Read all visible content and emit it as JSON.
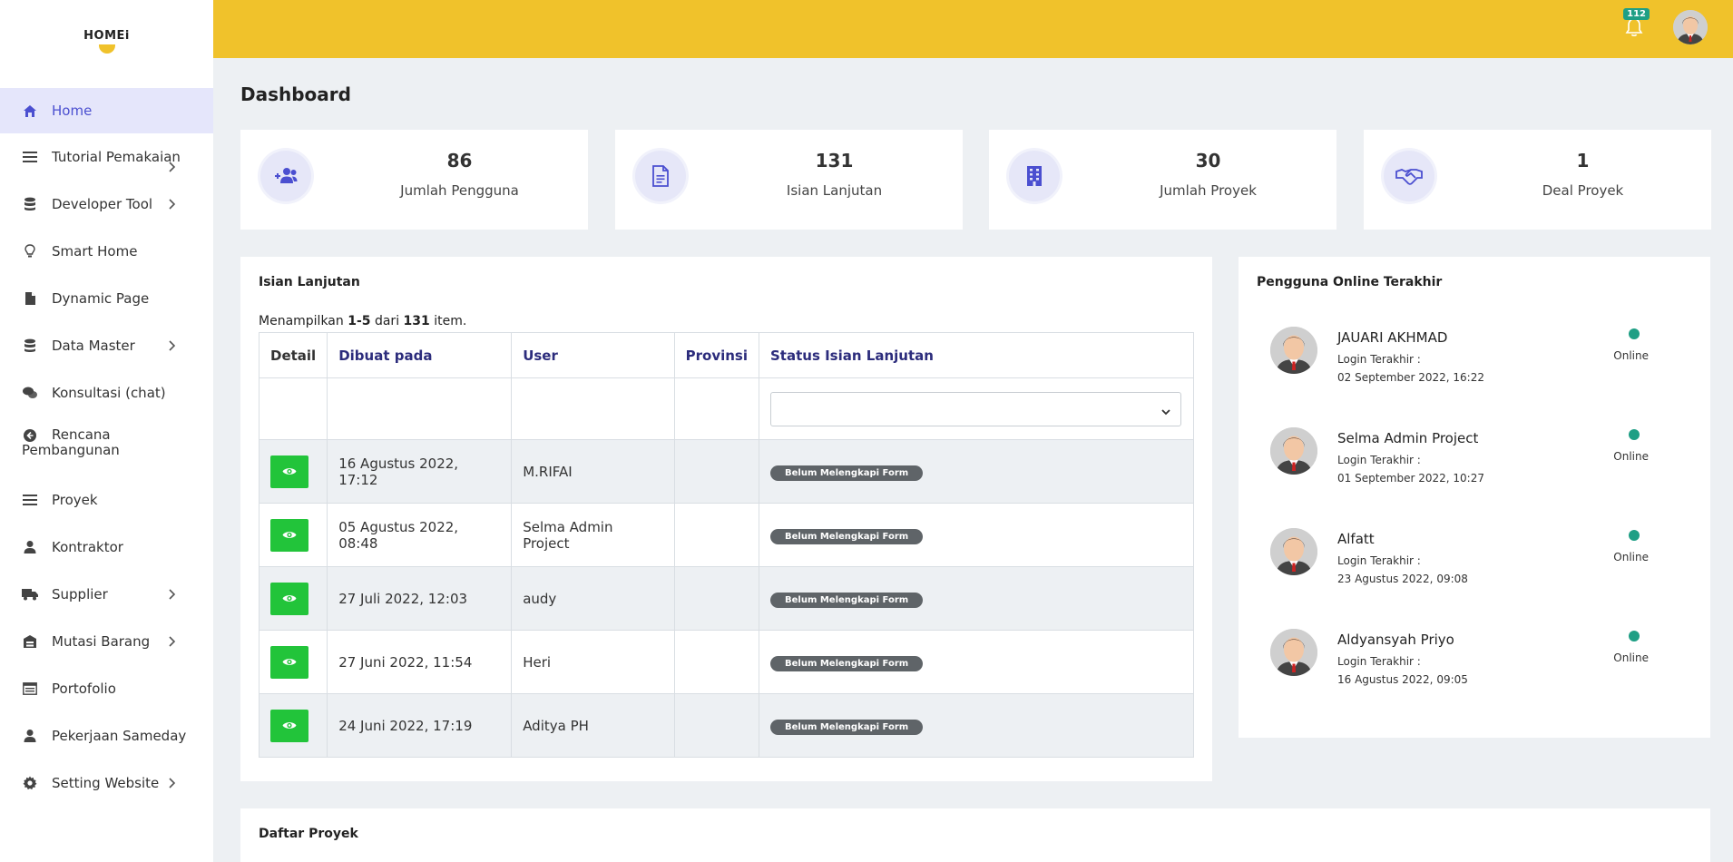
{
  "app": {
    "logo_text": "HOMEi"
  },
  "sidebar": {
    "items": [
      {
        "label": "Home"
      },
      {
        "label": "Tutorial Pemakaian"
      },
      {
        "label": "Developer Tool"
      },
      {
        "label": "Smart Home"
      },
      {
        "label": "Dynamic Page"
      },
      {
        "label": "Data Master"
      },
      {
        "label": "Konsultasi (chat)"
      },
      {
        "label": "Rencana Pembangunan"
      },
      {
        "label": "Proyek"
      },
      {
        "label": "Kontraktor"
      },
      {
        "label": "Supplier"
      },
      {
        "label": "Mutasi Barang"
      },
      {
        "label": "Portofolio"
      },
      {
        "label": "Pekerjaan Sameday"
      },
      {
        "label": "Setting Website"
      }
    ]
  },
  "topbar": {
    "notification_count": "112",
    "accent_color": "#f0c22b"
  },
  "page": {
    "title": "Dashboard"
  },
  "stats": [
    {
      "value": "86",
      "label": "Jumlah Pengguna",
      "icon": "user-plus-icon"
    },
    {
      "value": "131",
      "label": "Isian Lanjutan",
      "icon": "document-icon"
    },
    {
      "value": "30",
      "label": "Jumlah Proyek",
      "icon": "building-icon"
    },
    {
      "value": "1",
      "label": "Deal Proyek",
      "icon": "handshake-icon"
    }
  ],
  "isian": {
    "title": "Isian Lanjutan",
    "summary_prefix": "Menampilkan ",
    "summary_range": "1-5",
    "summary_mid": " dari ",
    "summary_total": "131",
    "summary_suffix": " item.",
    "columns": [
      "Detail",
      "Dibuat pada",
      "User",
      "Provinsi",
      "Status Isian Lanjutan"
    ],
    "rows": [
      {
        "created": "16 Agustus 2022, 17:12",
        "user": "M.RIFAI",
        "provinsi": "",
        "status": "Belum Melengkapi Form"
      },
      {
        "created": "05 Agustus 2022, 08:48",
        "user": "Selma Admin Project",
        "provinsi": "",
        "status": "Belum Melengkapi Form"
      },
      {
        "created": "27 Juli 2022, 12:03",
        "user": "audy",
        "provinsi": "",
        "status": "Belum Melengkapi Form"
      },
      {
        "created": "27 Juni 2022, 11:54",
        "user": "Heri",
        "provinsi": "",
        "status": "Belum Melengkapi Form"
      },
      {
        "created": "24 Juni 2022, 17:19",
        "user": "Aditya PH",
        "provinsi": "",
        "status": "Belum Melengkapi Form"
      }
    ]
  },
  "online": {
    "title": "Pengguna Online Terakhir",
    "login_label": "Login Terakhir :",
    "status_label": "Online",
    "users": [
      {
        "name": "JAUARI AKHMAD",
        "last_login": "02 September 2022, 16:22"
      },
      {
        "name": "Selma Admin Project",
        "last_login": "01 September 2022, 10:27"
      },
      {
        "name": "Alfatt",
        "last_login": "23 Agustus 2022, 09:08"
      },
      {
        "name": "Aldyansyah Priyo",
        "last_login": "16 Agustus 2022, 09:05"
      }
    ]
  },
  "proyek": {
    "title": "Daftar Proyek"
  }
}
